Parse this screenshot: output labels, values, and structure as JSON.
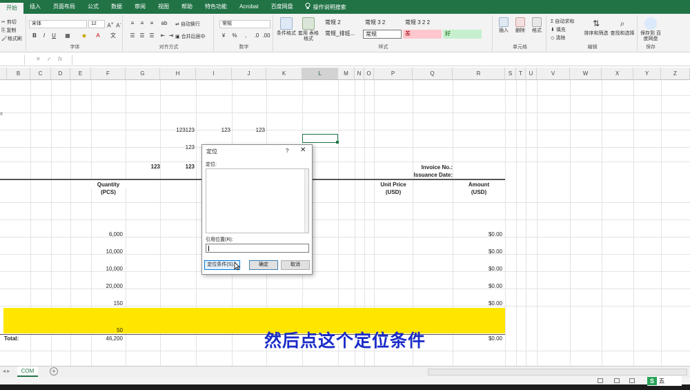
{
  "ribbon_tabs": [
    "开始",
    "插入",
    "页面布局",
    "公式",
    "数据",
    "审阅",
    "视图",
    "帮助",
    "特色功能",
    "Acrobat",
    "百度网盘"
  ],
  "active_tab_index": 0,
  "tell_me": "操作说明搜索",
  "clipboard": {
    "cut": "剪切",
    "copy": "复制",
    "format_painter": "格式刷"
  },
  "font": {
    "name": "宋体",
    "size": "12",
    "label": "字体"
  },
  "alignment": {
    "wrap": "自动换行",
    "merge": "合并后居中",
    "label": "对齐方式"
  },
  "number": {
    "format": "常规",
    "label": "数字"
  },
  "styles": {
    "conditional": "条件格式",
    "table": "套用 表格格式",
    "cells": [
      "常规 2",
      "常规 3 2",
      "常规 3 2 2",
      "常规_排班...",
      "常规",
      "差",
      "好"
    ],
    "label": "样式"
  },
  "cells_group": {
    "insert": "插入",
    "delete": "删除",
    "format": "格式",
    "label": "单元格"
  },
  "editing": {
    "autosum": "自动求和",
    "fill": "填充",
    "clear": "清除",
    "sort": "排序和筛选",
    "find": "查找和选择",
    "label": "编辑"
  },
  "save": {
    "button": "保存到 百度网盘",
    "label": "保存"
  },
  "columns": [
    "B",
    "C",
    "D",
    "E",
    "F",
    "G",
    "H",
    "I",
    "J",
    "K",
    "L",
    "M",
    "N",
    "O",
    "P",
    "Q",
    "R",
    "S",
    "T",
    "U",
    "V",
    "W",
    "X",
    "Y",
    "Z"
  ],
  "selected_column": "L",
  "sheet": {
    "h_123123": "123123",
    "i_123_a": "123",
    "j_123": "123",
    "h_123_b": "123",
    "g_123": "123",
    "h_123_c": "123",
    "invoice_no": "Invoice No.:",
    "issuance_date": "Issuance Date:",
    "quantity": "Quantity",
    "pcs": "(PCS)",
    "unit_price": "Unit Price",
    "usd1": "(USD)",
    "amount": "Amount",
    "usd2": "(USD)",
    "qty_values": [
      "6,000",
      "10,000",
      "10,000",
      "20,000",
      "150",
      "50"
    ],
    "amount_values": [
      "$0.00",
      "$0.00",
      "$0.00",
      "$0.00",
      "$0.00"
    ],
    "total_label": "Total:",
    "total_qty": "46,200",
    "total_amount": "$0.00"
  },
  "dialog": {
    "title": "定位",
    "help": "?",
    "close": "✕",
    "goto_label": "定位:",
    "ref_label": "引用位置(R):",
    "special_button": "定位条件(S)...",
    "ok_button": "确定",
    "cancel_button": "取消"
  },
  "subtitle": "然后点这个定位条件",
  "sheet_tab": "COM",
  "add_sheet": "+",
  "ime": {
    "s": "S",
    "mode": "五"
  },
  "colors": {
    "excel_green": "#217346",
    "highlight_yellow": "#ffe600",
    "subtitle_blue": "#1a2bc8"
  }
}
